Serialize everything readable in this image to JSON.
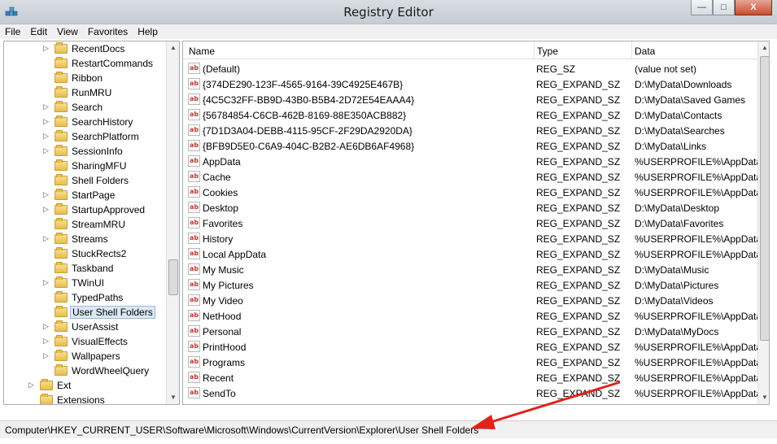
{
  "window": {
    "title": "Registry Editor",
    "icon": "registry-editor-icon"
  },
  "window_buttons": {
    "minimize": "—",
    "maximize": "□",
    "close": "X"
  },
  "menu": [
    "File",
    "Edit",
    "View",
    "Favorites",
    "Help"
  ],
  "tree": [
    {
      "label": "RecentDocs",
      "expandable": true
    },
    {
      "label": "RestartCommands",
      "expandable": false
    },
    {
      "label": "Ribbon",
      "expandable": false
    },
    {
      "label": "RunMRU",
      "expandable": false
    },
    {
      "label": "Search",
      "expandable": true
    },
    {
      "label": "SearchHistory",
      "expandable": true
    },
    {
      "label": "SearchPlatform",
      "expandable": true
    },
    {
      "label": "SessionInfo",
      "expandable": true
    },
    {
      "label": "SharingMFU",
      "expandable": false
    },
    {
      "label": "Shell Folders",
      "expandable": false
    },
    {
      "label": "StartPage",
      "expandable": true
    },
    {
      "label": "StartupApproved",
      "expandable": true
    },
    {
      "label": "StreamMRU",
      "expandable": false
    },
    {
      "label": "Streams",
      "expandable": true
    },
    {
      "label": "StuckRects2",
      "expandable": false
    },
    {
      "label": "Taskband",
      "expandable": false
    },
    {
      "label": "TWinUI",
      "expandable": true
    },
    {
      "label": "TypedPaths",
      "expandable": false
    },
    {
      "label": "User Shell Folders",
      "expandable": false,
      "selected": true
    },
    {
      "label": "UserAssist",
      "expandable": true
    },
    {
      "label": "VisualEffects",
      "expandable": true
    },
    {
      "label": "Wallpapers",
      "expandable": true
    },
    {
      "label": "WordWheelQuery",
      "expandable": false
    },
    {
      "label": "Ext",
      "expandable": true,
      "level": 2
    },
    {
      "label": "Extensions",
      "expandable": false,
      "level": 2
    }
  ],
  "columns": {
    "name": "Name",
    "type": "Type",
    "data": "Data"
  },
  "values": [
    {
      "name": "(Default)",
      "type": "REG_SZ",
      "data": "(value not set)"
    },
    {
      "name": "{374DE290-123F-4565-9164-39C4925E467B}",
      "type": "REG_EXPAND_SZ",
      "data": "D:\\MyData\\Downloads"
    },
    {
      "name": "{4C5C32FF-BB9D-43B0-B5B4-2D72E54EAAA4}",
      "type": "REG_EXPAND_SZ",
      "data": "D:\\MyData\\Saved Games"
    },
    {
      "name": "{56784854-C6CB-462B-8169-88E350ACB882}",
      "type": "REG_EXPAND_SZ",
      "data": "D:\\MyData\\Contacts"
    },
    {
      "name": "{7D1D3A04-DEBB-4115-95CF-2F29DA2920DA}",
      "type": "REG_EXPAND_SZ",
      "data": "D:\\MyData\\Searches"
    },
    {
      "name": "{BFB9D5E0-C6A9-404C-B2B2-AE6DB6AF4968}",
      "type": "REG_EXPAND_SZ",
      "data": "D:\\MyData\\Links"
    },
    {
      "name": "AppData",
      "type": "REG_EXPAND_SZ",
      "data": "%USERPROFILE%\\AppData\\R"
    },
    {
      "name": "Cache",
      "type": "REG_EXPAND_SZ",
      "data": "%USERPROFILE%\\AppData\\L"
    },
    {
      "name": "Cookies",
      "type": "REG_EXPAND_SZ",
      "data": "%USERPROFILE%\\AppData\\L"
    },
    {
      "name": "Desktop",
      "type": "REG_EXPAND_SZ",
      "data": "D:\\MyData\\Desktop"
    },
    {
      "name": "Favorites",
      "type": "REG_EXPAND_SZ",
      "data": "D:\\MyData\\Favorites"
    },
    {
      "name": "History",
      "type": "REG_EXPAND_SZ",
      "data": "%USERPROFILE%\\AppData\\L"
    },
    {
      "name": "Local AppData",
      "type": "REG_EXPAND_SZ",
      "data": "%USERPROFILE%\\AppData\\L"
    },
    {
      "name": "My Music",
      "type": "REG_EXPAND_SZ",
      "data": "D:\\MyData\\Music"
    },
    {
      "name": "My Pictures",
      "type": "REG_EXPAND_SZ",
      "data": "D:\\MyData\\Pictures"
    },
    {
      "name": "My Video",
      "type": "REG_EXPAND_SZ",
      "data": "D:\\MyData\\Videos"
    },
    {
      "name": "NetHood",
      "type": "REG_EXPAND_SZ",
      "data": "%USERPROFILE%\\AppData\\R"
    },
    {
      "name": "Personal",
      "type": "REG_EXPAND_SZ",
      "data": "D:\\MyData\\MyDocs"
    },
    {
      "name": "PrintHood",
      "type": "REG_EXPAND_SZ",
      "data": "%USERPROFILE%\\AppData\\R"
    },
    {
      "name": "Programs",
      "type": "REG_EXPAND_SZ",
      "data": "%USERPROFILE%\\AppData\\R"
    },
    {
      "name": "Recent",
      "type": "REG_EXPAND_SZ",
      "data": "%USERPROFILE%\\AppData\\R"
    },
    {
      "name": "SendTo",
      "type": "REG_EXPAND_SZ",
      "data": "%USERPROFILE%\\AppData\\R"
    }
  ],
  "value_icon_text": "ab",
  "status": {
    "path": "Computer\\HKEY_CURRENT_USER\\Software\\Microsoft\\Windows\\CurrentVersion\\Explorer\\User Shell Folders"
  },
  "colors": {
    "annotation_arrow": "#e0231c",
    "selection": "#dce8f5"
  }
}
